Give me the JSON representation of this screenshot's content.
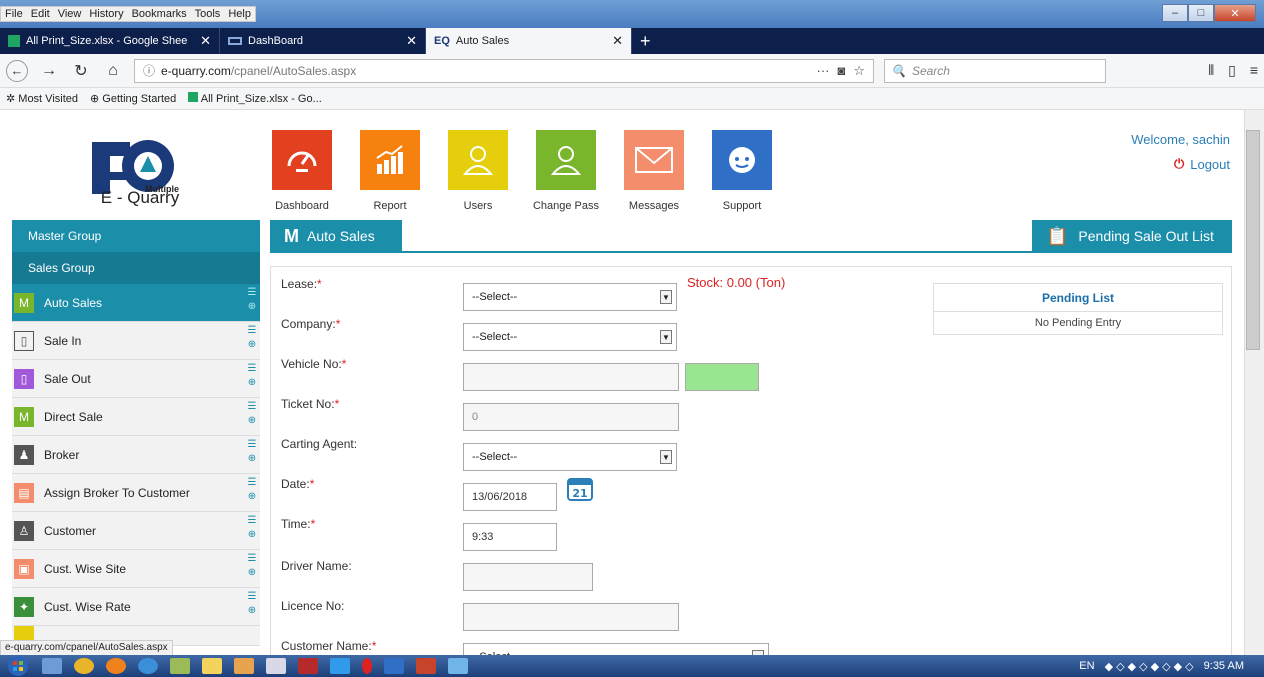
{
  "menubar": {
    "items": [
      "File",
      "Edit",
      "View",
      "History",
      "Bookmarks",
      "Tools",
      "Help"
    ]
  },
  "tabs": [
    {
      "label": "All Print_Size.xlsx - Google Shee"
    },
    {
      "label": "DashBoard"
    },
    {
      "label": "Auto Sales"
    }
  ],
  "nav": {
    "url_domain": "e-quarry.com",
    "url_path": "/cpanel/AutoSales.aspx",
    "search_placeholder": "Search"
  },
  "bookmarks": [
    "Most Visited",
    "Getting Started",
    "All Print_Size.xlsx - Go..."
  ],
  "logo": {
    "text": "E - Quarry",
    "multiple": "Multiple"
  },
  "tiles": [
    {
      "label": "Dashboard",
      "color": "#e2401e",
      "icon": "speedometer-icon"
    },
    {
      "label": "Report",
      "color": "#f7810e",
      "icon": "chart-icon"
    },
    {
      "label": "Users",
      "color": "#e5cf0d",
      "icon": "user-icon"
    },
    {
      "label": "Change Pass",
      "color": "#7ab62c",
      "icon": "user-key-icon"
    },
    {
      "label": "Messages",
      "color": "#f48d6c",
      "icon": "envelope-icon"
    },
    {
      "label": "Support",
      "color": "#2f6fc6",
      "icon": "headset-icon"
    }
  ],
  "welcome": "Welcome, sachin",
  "logout": "Logout",
  "sidebar": {
    "master": "Master Group",
    "sales": "Sales Group",
    "items": [
      {
        "label": "Auto Sales",
        "color": "#7ab62c"
      },
      {
        "label": "Sale In",
        "color": "#555555"
      },
      {
        "label": "Sale Out",
        "color": "#a259d9"
      },
      {
        "label": "Direct Sale",
        "color": "#7ab62c"
      },
      {
        "label": "Broker",
        "color": "#555555"
      },
      {
        "label": "Assign Broker To Customer",
        "color": "#f48d6c"
      },
      {
        "label": "Customer",
        "color": "#555555"
      },
      {
        "label": "Cust. Wise Site",
        "color": "#f48d6c"
      },
      {
        "label": "Cust. Wise Rate",
        "color": "#3a8f3a"
      }
    ]
  },
  "header": {
    "auto_sales": "Auto Sales",
    "pending": "Pending Sale Out List"
  },
  "form": {
    "lease": "Lease:",
    "company": "Company:",
    "vehicle": "Vehicle No:",
    "ticket": "Ticket No:",
    "carting": "Carting Agent:",
    "date": "Date:",
    "time": "Time:",
    "driver": "Driver Name:",
    "licence": "Licence No:",
    "customer": "Customer Name:",
    "select": "--Select--",
    "ticket_value": "0",
    "date_value": "13/06/2018",
    "time_value": "9:33",
    "stock": "Stock: 0.00 (Ton)"
  },
  "pending": {
    "title": "Pending List",
    "empty": "No Pending Entry"
  },
  "status_url": "e-quarry.com/cpanel/AutoSales.aspx",
  "taskbar": {
    "lang": "EN",
    "time": "9:35 AM"
  }
}
